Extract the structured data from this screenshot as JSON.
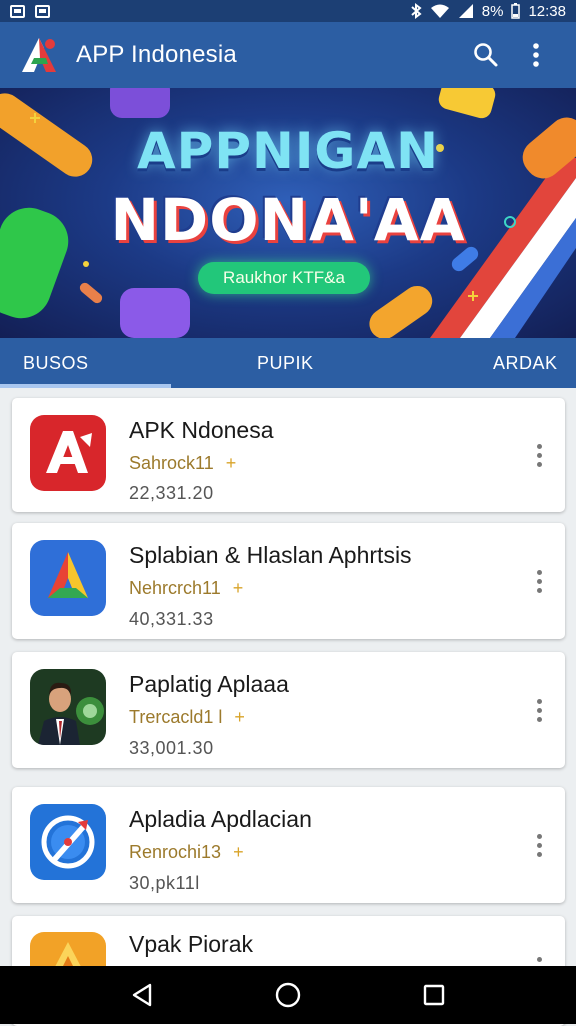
{
  "status_bar": {
    "battery": "8%",
    "time": "12:38"
  },
  "app_bar": {
    "title": "APP Indonesia"
  },
  "banner": {
    "line1": "APPNIGAN",
    "line2": "NDONA'AA",
    "pill": "Raukhor KTF&a"
  },
  "tabs": [
    {
      "label": "BUSOS",
      "selected": true
    },
    {
      "label": "PUPIK",
      "selected": false
    },
    {
      "label": "ARDAK",
      "selected": false
    }
  ],
  "apps": [
    {
      "name": "APK Ndonesa",
      "developer": "Sahrock11",
      "plus": "+",
      "count": "22,331.20",
      "icon": "red-a-logo-icon"
    },
    {
      "name": "Splabian & Hlaslan Aphrtsis",
      "developer": "Nehrcrch11",
      "plus": "+",
      "count": "40,331.33",
      "icon": "colorful-triangle-logo-icon"
    },
    {
      "name": "Paplatig Aplaaa",
      "developer": "Trercacld1 l",
      "plus": "+",
      "count": "33,001.30",
      "icon": "man-portrait-icon"
    },
    {
      "name": "Apladia Apdlacian",
      "developer": "Renrochi13",
      "plus": "+",
      "count": "30,pk11l",
      "icon": "compass-logo-icon"
    },
    {
      "name": "Vpak Piorak",
      "developer": "",
      "plus": "",
      "count": "",
      "icon": "orange-triangle-logo-icon"
    }
  ],
  "colors": {
    "app_bar": "#2c5ea3",
    "status_bar": "#1c3f74",
    "accent_gold": "#9c7a2c"
  }
}
